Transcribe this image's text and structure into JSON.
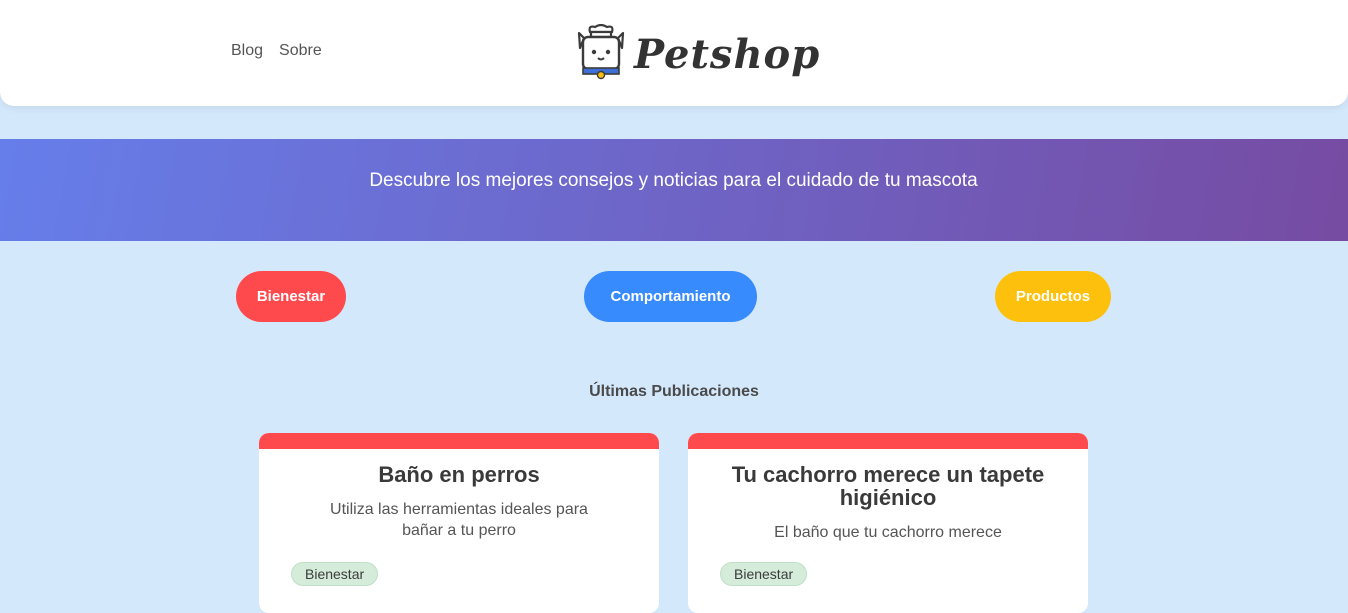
{
  "header": {
    "nav": [
      {
        "label": "Blog"
      },
      {
        "label": "Sobre"
      }
    ],
    "logo_text": "Petshop",
    "logo_icon": "dog-logo-icon"
  },
  "banner": {
    "text": "Descubre los mejores consejos y noticias para el cuidado de tu mascota"
  },
  "categories": [
    {
      "label": "Bienestar",
      "color": "#ff4a4d"
    },
    {
      "label": "Comportamiento",
      "color": "#388bfc"
    },
    {
      "label": "Productos",
      "color": "#fdc10d"
    }
  ],
  "section": {
    "title": "Últimas Publicaciones"
  },
  "posts": [
    {
      "title": "Baño en perros",
      "description": "Utiliza las herramientas ideales para bañar a tu perro",
      "tag": "Bienestar",
      "color": "#ff4a4d"
    },
    {
      "title": "Tu cachorro merece un tapete higiénico",
      "description": "El baño que tu cachorro merece",
      "tag": "Bienestar",
      "color": "#ff4a4d"
    }
  ],
  "colors": {
    "background": "#d4e8fc",
    "banner_start": "#667eea",
    "banner_end": "#764ba2",
    "tag_bg": "#d4ecd9"
  }
}
